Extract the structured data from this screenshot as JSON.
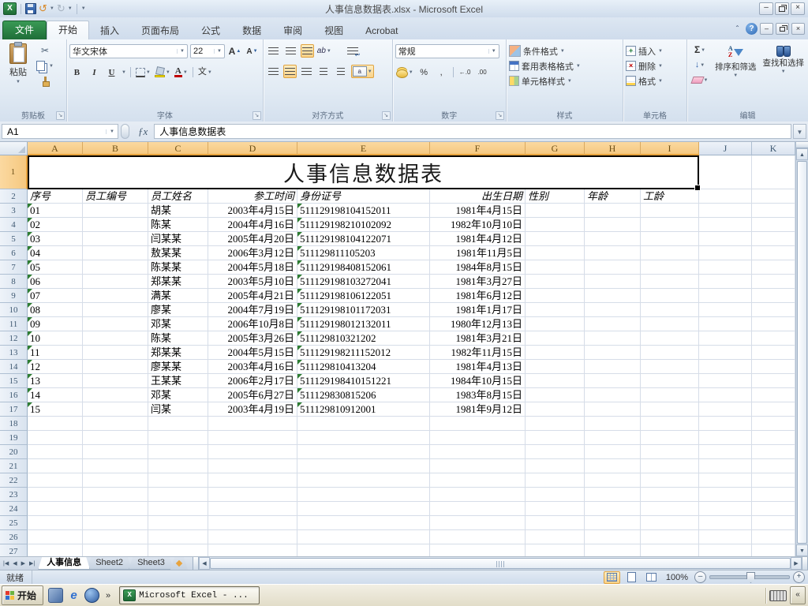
{
  "window": {
    "title": "人事信息数据表.xlsx  -  Microsoft Excel"
  },
  "icons": {
    "scissors": "✂",
    "undo": "↺",
    "redo": "↻",
    "help": "?",
    "sum": "Σ",
    "fill_down": "↓",
    "orientation": "ab",
    "min": "–",
    "close": "×",
    "collapse_ribbon": "⌃",
    "nav_first": "⏴",
    "nav_prev": "◀",
    "nav_next": "▶",
    "chevrons_right": "»",
    "chevrons_left": "«"
  },
  "ribbon_tabs": [
    {
      "label": "文件",
      "file": true
    },
    {
      "label": "开始",
      "active": true
    },
    {
      "label": "插入"
    },
    {
      "label": "页面布局"
    },
    {
      "label": "公式"
    },
    {
      "label": "数据"
    },
    {
      "label": "审阅"
    },
    {
      "label": "视图"
    },
    {
      "label": "Acrobat"
    }
  ],
  "ribbon": {
    "clipboard": {
      "label": "剪贴板",
      "paste_label": "粘贴"
    },
    "font": {
      "label": "字体",
      "font_name": "华文宋体",
      "font_size": "22",
      "bold": "B",
      "italic": "I",
      "underline": "U",
      "phonetic": "文"
    },
    "alignment": {
      "label": "对齐方式"
    },
    "number": {
      "label": "数字",
      "format": "常规",
      "percent": "%",
      "comma": ",",
      "inc_decimal": "←.0",
      "dec_decimal": ".00"
    },
    "styles": {
      "label": "样式",
      "items": [
        "条件格式",
        "套用表格格式",
        "单元格样式"
      ]
    },
    "cells": {
      "label": "单元格",
      "items": [
        "插入",
        "删除",
        "格式"
      ]
    },
    "editing": {
      "label": "编辑",
      "sort_label": "排序和筛选",
      "find_label": "查找和选择"
    }
  },
  "formula_bar": {
    "cell_ref": "A1",
    "formula": "人事信息数据表"
  },
  "grid": {
    "columns": [
      "A",
      "B",
      "C",
      "D",
      "E",
      "F",
      "G",
      "H",
      "I",
      "J",
      "K"
    ],
    "selected_last_col_index": 8,
    "visible_row_count": 27,
    "title_cell": "人事信息数据表",
    "header_row": [
      "序号",
      "员工编号",
      "员工姓名",
      "参工时间",
      "身份证号",
      "出生日期",
      "性别",
      "年龄",
      "工龄"
    ],
    "col_align": [
      "left",
      "left",
      "left",
      "right",
      "left",
      "right",
      "left",
      "left",
      "left"
    ],
    "error_flag_cols": [
      0,
      4
    ],
    "data_rows": [
      [
        "01",
        "",
        "胡某",
        "2003年4月15日",
        "511129198104152011",
        "1981年4月15日",
        "",
        "",
        ""
      ],
      [
        "02",
        "",
        "陈某",
        "2004年4月16日",
        "511129198210102092",
        "1982年10月10日",
        "",
        "",
        ""
      ],
      [
        "03",
        "",
        "闫某某",
        "2005年4月20日",
        "511129198104122071",
        "1981年4月12日",
        "",
        "",
        ""
      ],
      [
        "04",
        "",
        "敖某某",
        "2006年3月12日",
        "511129811105203",
        "1981年11月5日",
        "",
        "",
        ""
      ],
      [
        "05",
        "",
        "陈某某",
        "2004年5月18日",
        "511129198408152061",
        "1984年8月15日",
        "",
        "",
        ""
      ],
      [
        "06",
        "",
        "郑某某",
        "2003年5月10日",
        "511129198103272041",
        "1981年3月27日",
        "",
        "",
        ""
      ],
      [
        "07",
        "",
        "满某",
        "2005年4月21日",
        "511129198106122051",
        "1981年6月12日",
        "",
        "",
        ""
      ],
      [
        "08",
        "",
        "廖某",
        "2004年7月19日",
        "511129198101172031",
        "1981年1月17日",
        "",
        "",
        ""
      ],
      [
        "09",
        "",
        "邓某",
        "2006年10月8日",
        "511129198012132011",
        "1980年12月13日",
        "",
        "",
        ""
      ],
      [
        "10",
        "",
        "陈某",
        "2005年3月26日",
        "511129810321202",
        "1981年3月21日",
        "",
        "",
        ""
      ],
      [
        "11",
        "",
        "郑某某",
        "2004年5月15日",
        "511129198211152012",
        "1982年11月15日",
        "",
        "",
        ""
      ],
      [
        "12",
        "",
        "廖某某",
        "2003年4月16日",
        "511129810413204",
        "1981年4月13日",
        "",
        "",
        ""
      ],
      [
        "13",
        "",
        "王某某",
        "2006年2月17日",
        "511129198410151221",
        "1984年10月15日",
        "",
        "",
        ""
      ],
      [
        "14",
        "",
        "邓某",
        "2005年6月27日",
        "511129830815206",
        "1983年8月15日",
        "",
        "",
        ""
      ],
      [
        "15",
        "",
        "闫某",
        "2003年4月19日",
        "511129810912001",
        "1981年9月12日",
        "",
        "",
        ""
      ]
    ]
  },
  "sheet_tabs": [
    {
      "label": "人事信息",
      "active": true
    },
    {
      "label": "Sheet2"
    },
    {
      "label": "Sheet3"
    }
  ],
  "status_bar": {
    "mode": "就绪",
    "zoom_level": "100%"
  },
  "taskbar": {
    "start_label": "开始",
    "active_task": "Microsoft Excel - ..."
  }
}
